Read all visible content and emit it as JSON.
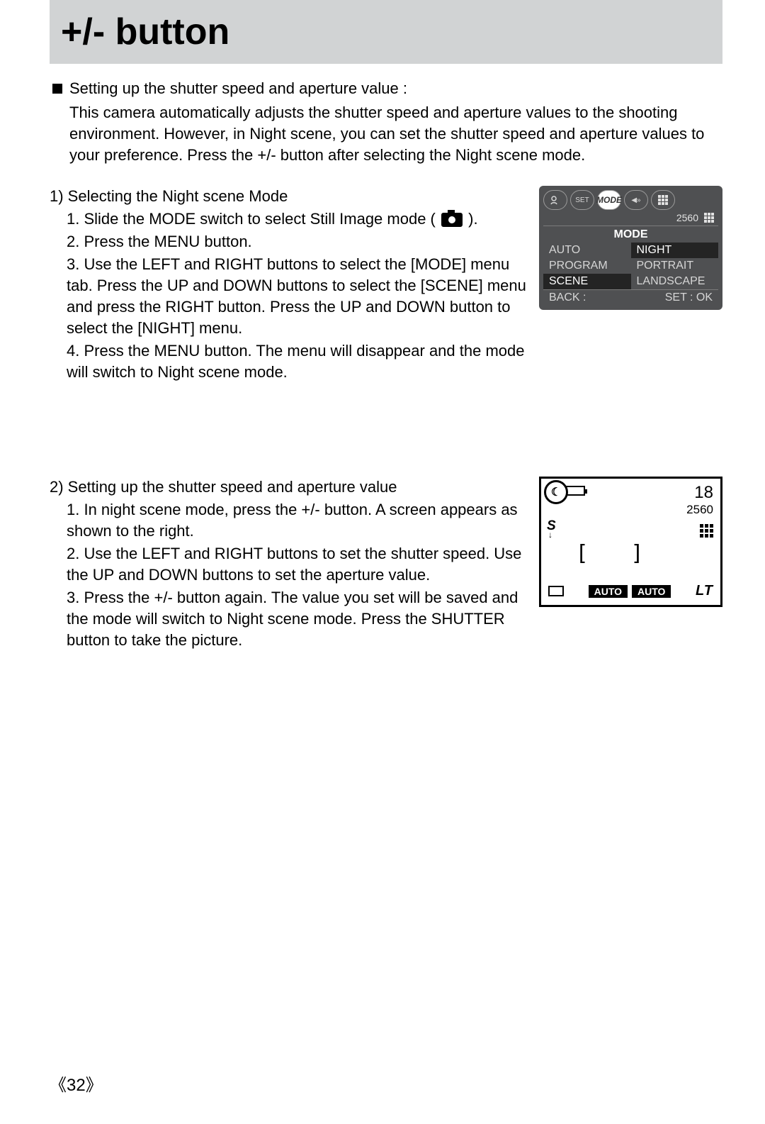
{
  "title": "+/- button",
  "intro_heading": "Setting up the shutter speed and aperture value :",
  "intro_body": "This camera automatically adjusts the shutter speed and aperture values to the shooting environment. However, in Night scene, you can set the shutter speed and aperture values to your preference. Press the +/- button after selecting the Night scene mode.",
  "section1": {
    "title": "1) Selecting the Night scene Mode",
    "step1a": "1. Slide the MODE switch to select Still Image mode (",
    "step1b": ").",
    "step2": "2. Press the MENU button.",
    "step3": "3. Use the LEFT and RIGHT buttons to select the [MODE] menu tab. Press the UP and DOWN buttons to select the [SCENE] menu and press the RIGHT button. Press the UP and DOWN button to select the [NIGHT] menu.",
    "step4": "4. Press the MENU button. The menu will disappear and the mode will switch to Night scene mode."
  },
  "section2": {
    "title": "2) Setting up the shutter speed and aperture value",
    "step1": "1. In night scene mode, press the +/- button. A screen appears as shown to the right.",
    "step2": "2. Use the LEFT and RIGHT buttons to set the shutter speed. Use the UP and DOWN buttons to set the aperture value.",
    "step3": "3. Press the +/- button again. The value you set will be saved and the mode will switch to Night scene mode. Press the SHUTTER button to take the picture."
  },
  "menu": {
    "tab_set": "SET",
    "tab_mode": "MODE",
    "resolution": "2560",
    "header": "MODE",
    "auto": "AUTO",
    "night": "NIGHT",
    "program": "PROGRAM",
    "portrait": "PORTRAIT",
    "scene": "SCENE",
    "landscape": "LANDSCAPE",
    "back": "BACK :",
    "set_ok": "SET : OK"
  },
  "night": {
    "moon": "☾",
    "count": "18",
    "resolution": "2560",
    "flash_label": "S",
    "bracket_left": "[",
    "bracket_right": "]",
    "auto1": "AUTO",
    "auto2": "AUTO",
    "lt": "LT"
  },
  "page_number": "《32》"
}
